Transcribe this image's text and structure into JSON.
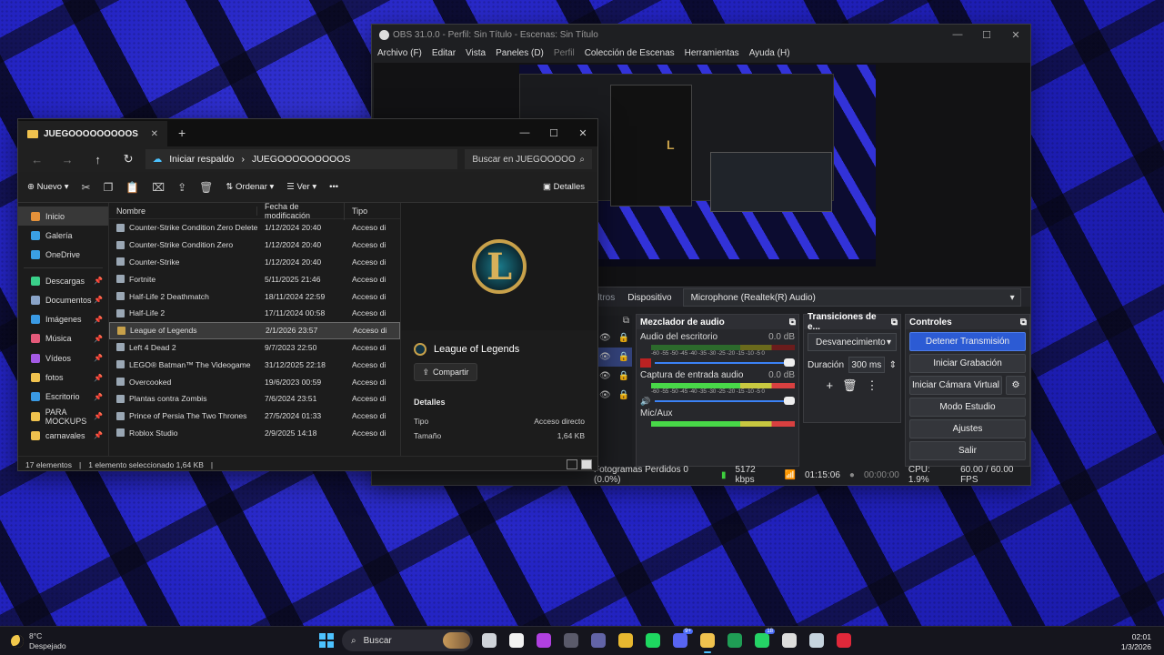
{
  "obs": {
    "title": "OBS 31.0.0 - Perfil: Sin Título - Escenas: Sin Título",
    "menu": [
      "Archivo (F)",
      "Editar",
      "Vista",
      "Paneles (D)",
      "Perfil",
      "Colección de Escenas",
      "Herramientas",
      "Ayuda (H)"
    ],
    "source_bar": {
      "filters": "Filtros",
      "device_label": "Dispositivo",
      "device_value": "Microphone (Realtek(R) Audio)"
    },
    "mixer": {
      "title": "Mezclador de audio",
      "scale": "-60 -55 -50 -45 -40 -35 -30 -25 -20 -15 -10 -5 0",
      "channels": [
        {
          "name": "Audio del escritorio",
          "db": "0.0 dB",
          "level": 0.0
        },
        {
          "name": "Captura de entrada audio",
          "db": "0.0 dB",
          "level": 0.8
        },
        {
          "name": "Mic/Aux",
          "db": "0.0 dB",
          "level": 0.8
        }
      ]
    },
    "transitions": {
      "title": "Transiciones de e...",
      "type": "Desvanecimiento",
      "duration_label": "Duración",
      "duration_value": "300 ms"
    },
    "controls": {
      "title": "Controles",
      "stop_stream": "Detener Transmisión",
      "start_record": "Iniciar Grabación",
      "virtual_cam": "Iniciar Cámara Virtual",
      "studio_mode": "Modo Estudio",
      "settings": "Ajustes",
      "exit": "Salir"
    },
    "status": {
      "dropped": "Fotogramas Perdidos 0 (0.0%)",
      "bitrate": "5172 kbps",
      "stream_time": "01:15:06",
      "rec_time": "00:00:00",
      "cpu": "CPU: 1.9%",
      "fps": "60.00 / 60.00 FPS"
    },
    "accent": "#2c5bd4"
  },
  "explorer": {
    "tab_title": "JUEGOOOOOOOOOS",
    "backup": "Iniciar respaldo",
    "path": "JUEGOOOOOOOOOS",
    "search_placeholder": "Buscar en JUEGOOOOO",
    "toolbar": {
      "new": "Nuevo",
      "sort": "Ordenar",
      "view": "Ver",
      "details": "Detalles"
    },
    "nav": [
      {
        "label": "Inicio",
        "color": "#e4913a"
      },
      {
        "label": "Galería",
        "color": "#3aa0e4"
      },
      {
        "label": "OneDrive",
        "color": "#3aa0e4"
      },
      {
        "label": "Descargas",
        "color": "#3ad08a"
      },
      {
        "label": "Documentos",
        "color": "#8aa4c8"
      },
      {
        "label": "Imágenes",
        "color": "#3a9ae4"
      },
      {
        "label": "Música",
        "color": "#e45a7a"
      },
      {
        "label": "Vídeos",
        "color": "#a45ae4"
      },
      {
        "label": "fotos",
        "color": "#f0c24e"
      },
      {
        "label": "Escritorio",
        "color": "#3a9ae4"
      },
      {
        "label": "PARA MOCKUPS",
        "color": "#f0c24e"
      },
      {
        "label": "carnavales",
        "color": "#f0c24e"
      }
    ],
    "columns": [
      "Nombre",
      "Fecha de modificación",
      "Tipo"
    ],
    "files": [
      {
        "name": "Counter-Strike Condition Zero Deleted S...",
        "date": "1/12/2024 20:40",
        "type": "Acceso dir"
      },
      {
        "name": "Counter-Strike Condition Zero",
        "date": "1/12/2024 20:40",
        "type": "Acceso dir"
      },
      {
        "name": "Counter-Strike",
        "date": "1/12/2024 20:40",
        "type": "Acceso dir"
      },
      {
        "name": "Fortnite",
        "date": "5/11/2025 21:46",
        "type": "Acceso dir"
      },
      {
        "name": "Half-Life 2 Deathmatch",
        "date": "18/11/2024 22:59",
        "type": "Acceso dir"
      },
      {
        "name": "Half-Life 2",
        "date": "17/11/2024 00:58",
        "type": "Acceso dir"
      },
      {
        "name": "League of Legends",
        "date": "2/1/2026 23:57",
        "type": "Acceso dir"
      },
      {
        "name": "Left 4 Dead 2",
        "date": "9/7/2023 22:50",
        "type": "Acceso dir"
      },
      {
        "name": "LEGO® Batman™ The Videogame",
        "date": "31/12/2025 22:18",
        "type": "Acceso dir"
      },
      {
        "name": "Overcooked",
        "date": "19/6/2023 00:59",
        "type": "Acceso dir"
      },
      {
        "name": "Plantas contra Zombis",
        "date": "7/6/2024 23:51",
        "type": "Acceso dir"
      },
      {
        "name": "Prince of Persia The Two Thrones",
        "date": "27/5/2024 01:33",
        "type": "Acceso dir"
      },
      {
        "name": "Roblox Studio",
        "date": "2/9/2025 14:18",
        "type": "Acceso dir"
      }
    ],
    "preview": {
      "title": "League of Legends",
      "share": "Compartir",
      "details_header": "Detalles",
      "rows": [
        {
          "k": "Tipo",
          "v": "Acceso directo"
        },
        {
          "k": "Tamaño",
          "v": "1,64 KB"
        }
      ]
    },
    "status": {
      "count": "17 elementos",
      "selected": "1 elemento seleccionado  1,64 KB"
    }
  },
  "taskbar": {
    "weather_temp": "8°C",
    "weather_desc": "Despejado",
    "search": "Buscar",
    "time": "02:01",
    "date": "1/3/2026",
    "apps": [
      {
        "name": "task-view-icon",
        "color": "#cfd3da"
      },
      {
        "name": "file-icon",
        "color": "#f2f2f2"
      },
      {
        "name": "circle-app-icon",
        "color": "#b040e0"
      },
      {
        "name": "cube-app-icon",
        "color": "#5a5a6a"
      },
      {
        "name": "teams-icon",
        "color": "#6264a7"
      },
      {
        "name": "chrome-icon",
        "color": "#e8b830"
      },
      {
        "name": "spotify-icon",
        "color": "#1ed760"
      },
      {
        "name": "discord-icon",
        "color": "#5865f2",
        "badge": "9+"
      },
      {
        "name": "explorer-icon",
        "color": "#f0c24e",
        "active": true
      },
      {
        "name": "excel-icon",
        "color": "#1f9d55"
      },
      {
        "name": "whatsapp-icon",
        "color": "#25d366",
        "badge": "18"
      },
      {
        "name": "gamepad-icon",
        "color": "#ddd"
      },
      {
        "name": "steam-icon",
        "color": "#c6d4df"
      },
      {
        "name": "record-app-icon",
        "color": "#e0283a"
      }
    ]
  }
}
